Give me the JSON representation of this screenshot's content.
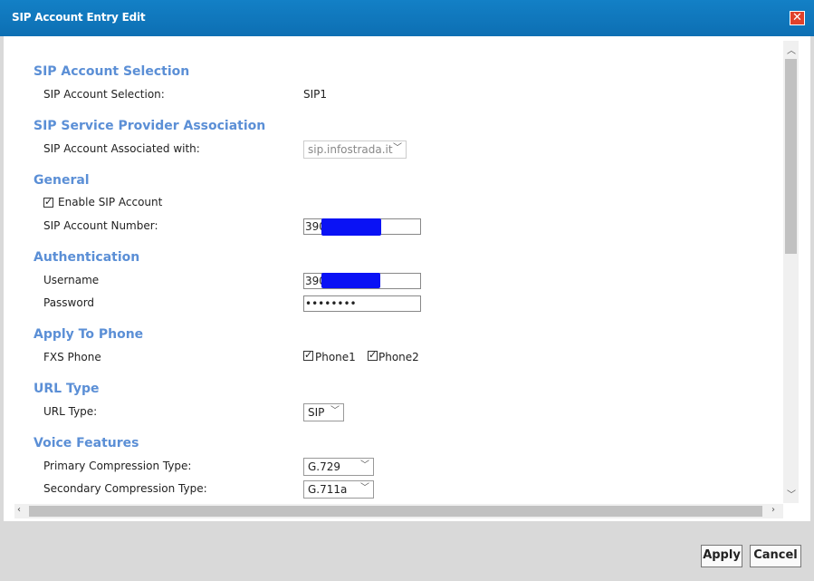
{
  "dialog": {
    "title": "SIP Account Entry Edit",
    "close_label": "✕"
  },
  "sections": {
    "account_selection": {
      "heading": "SIP Account Selection",
      "label": "SIP Account Selection:",
      "value": "SIP1"
    },
    "provider": {
      "heading": "SIP Service Provider Association",
      "label": "SIP Account Associated with:",
      "value": "sip.infostrada.it"
    },
    "general": {
      "heading": "General",
      "enable_label": "Enable SIP Account",
      "enable_checked": true,
      "number_label": "SIP Account Number:",
      "number_value": "390"
    },
    "authentication": {
      "heading": "Authentication",
      "username_label": "Username",
      "username_value": "390",
      "password_label": "Password",
      "password_value": "••••••••"
    },
    "apply_to_phone": {
      "heading": "Apply To Phone",
      "label": "FXS Phone",
      "phone1": "Phone1",
      "phone2": "Phone2",
      "phone1_checked": true,
      "phone2_checked": true
    },
    "url_type": {
      "heading": "URL Type",
      "label": "URL Type:",
      "value": "SIP"
    },
    "voice": {
      "heading": "Voice Features",
      "primary_label": "Primary Compression Type:",
      "primary_value": "G.729",
      "secondary_label": "Secondary Compression Type:",
      "secondary_value": "G.711a"
    }
  },
  "buttons": {
    "apply": "Apply",
    "cancel": "Cancel"
  },
  "colors": {
    "titlebar": "#0d6fb3",
    "section_heading": "#5b8fd6",
    "redaction": "#0a12f5",
    "close": "#e0412a"
  }
}
